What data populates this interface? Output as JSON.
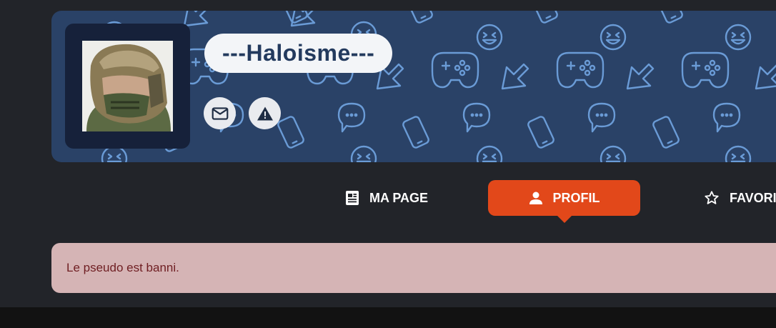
{
  "profile": {
    "username": "---Haloisme---",
    "avatar_icon": "spartan-helmet-avatar",
    "actions": [
      {
        "name": "message-button",
        "icon": "mail-icon"
      },
      {
        "name": "report-button",
        "icon": "warning-icon"
      }
    ]
  },
  "nav": {
    "items": [
      {
        "label": "MA PAGE",
        "icon": "page-icon",
        "active": false
      },
      {
        "label": "PROFIL",
        "icon": "user-icon",
        "active": true
      },
      {
        "label": "FAVORIS",
        "icon": "star-icon",
        "active": false
      }
    ]
  },
  "alert": {
    "message": "Le pseudo est banni."
  },
  "colors": {
    "background": "#222429",
    "banner": "#2a4267",
    "banner_pattern": "#6a9bd6",
    "accent": "#e2481a",
    "alert_bg": "#d5b4b5",
    "alert_text": "#6f1e22"
  }
}
